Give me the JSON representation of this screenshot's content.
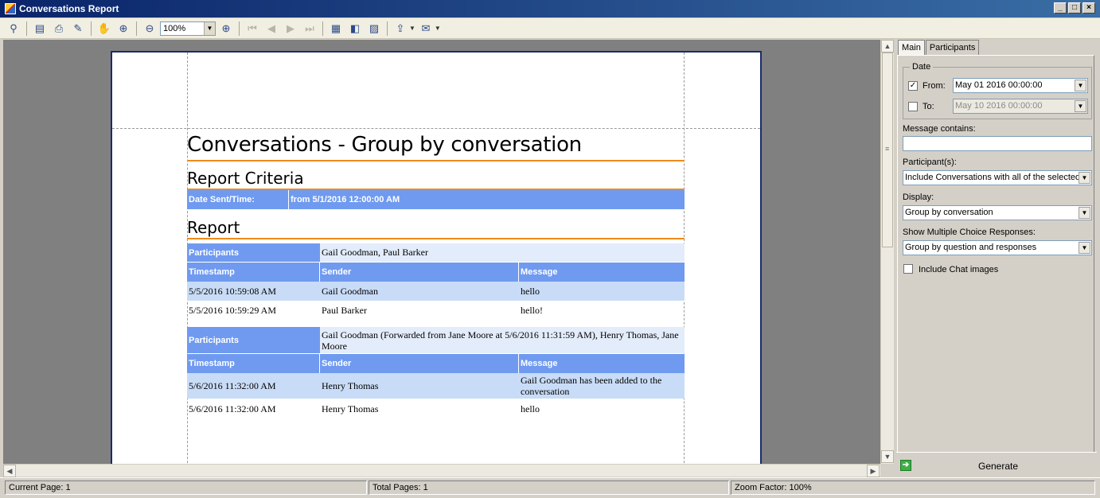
{
  "window": {
    "title": "Conversations Report",
    "min": "_",
    "max": "□",
    "close": "×"
  },
  "toolbar": {
    "zoom_value": "100%"
  },
  "report": {
    "title": "Conversations - Group by conversation",
    "criteria_heading": "Report Criteria",
    "criteria_label": "Date Sent/Time:",
    "criteria_value": "from 5/1/2016 12:00:00 AM",
    "report_heading": "Report",
    "col_timestamp": "Timestamp",
    "col_sender": "Sender",
    "col_message": "Message",
    "participants_label": "Participants",
    "groups": [
      {
        "participants": "Gail Goodman, Paul Barker",
        "rows": [
          {
            "timestamp": "5/5/2016 10:59:08 AM",
            "sender": "Gail Goodman",
            "message": "hello"
          },
          {
            "timestamp": "5/5/2016 10:59:29 AM",
            "sender": "Paul Barker",
            "message": "hello!"
          }
        ]
      },
      {
        "participants": "Gail Goodman (Forwarded from Jane Moore at 5/6/2016 11:31:59 AM), Henry Thomas, Jane Moore",
        "rows": [
          {
            "timestamp": "5/6/2016 11:32:00 AM",
            "sender": "Henry Thomas",
            "message": "Gail Goodman has been added to the conversation"
          },
          {
            "timestamp": "5/6/2016 11:32:00 AM",
            "sender": "Henry Thomas",
            "message": "hello"
          }
        ]
      }
    ]
  },
  "panel": {
    "tabs": [
      "Main",
      "Participants"
    ],
    "date_group": "Date",
    "from_label": "From:",
    "from_checked": "✓",
    "from_value": "May 01 2016 00:00:00",
    "to_label": "To:",
    "to_value": "May 10 2016 00:00:00",
    "message_contains_label": "Message contains:",
    "message_contains_value": "",
    "participants_label": "Participant(s):",
    "participants_value": "Include Conversations with all of the selected",
    "display_label": "Display:",
    "display_value": "Group by conversation",
    "mc_label": "Show Multiple Choice Responses:",
    "mc_value": "Group by question and responses",
    "chat_images_label": "Include Chat images",
    "generate_label": "Generate"
  },
  "status": {
    "current_page": "Current Page: 1",
    "total_pages": "Total Pages: 1",
    "zoom_factor": "Zoom Factor: 100%"
  }
}
